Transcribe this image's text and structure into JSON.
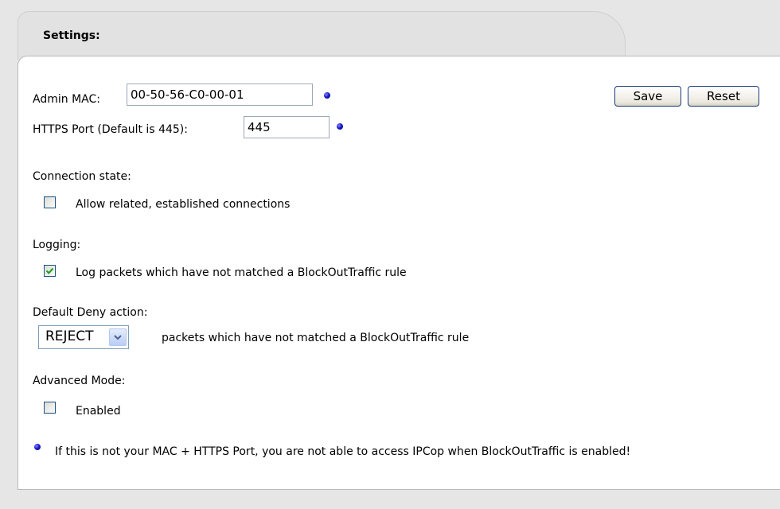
{
  "header": {
    "title": "Settings:"
  },
  "admin_mac": {
    "label": "Admin MAC:",
    "value": "00-50-56-C0-00-01"
  },
  "https_port": {
    "label": "HTTPS Port (Default is 445):",
    "value": "445"
  },
  "buttons": {
    "save": "Save",
    "reset": "Reset"
  },
  "connection_state": {
    "heading": "Connection state:",
    "checkbox_label": "Allow related, established connections",
    "checked": false
  },
  "logging": {
    "heading": "Logging:",
    "checkbox_label": "Log packets which have not matched a BlockOutTraffic rule",
    "checked": true
  },
  "default_deny": {
    "heading": "Default Deny action:",
    "selected": "REJECT",
    "suffix": "packets which have not matched a BlockOutTraffic rule"
  },
  "advanced_mode": {
    "heading": "Advanced Mode:",
    "checkbox_label": "Enabled",
    "checked": false
  },
  "note": {
    "text": "If this is not your MAC + HTTPS Port, you are not able to access IPCop when BlockOutTraffic is enabled!"
  },
  "colors": {
    "page_bg": "#e6e6e6",
    "panel_bg": "#ffffff",
    "tab_bg": "#e2e2e2",
    "dot": "#1a1ad0",
    "check": "#21a121"
  },
  "icons": {
    "note_dot": "blue-bullet-icon",
    "check": "checkmark-icon",
    "dropdown": "chevron-down-icon"
  }
}
